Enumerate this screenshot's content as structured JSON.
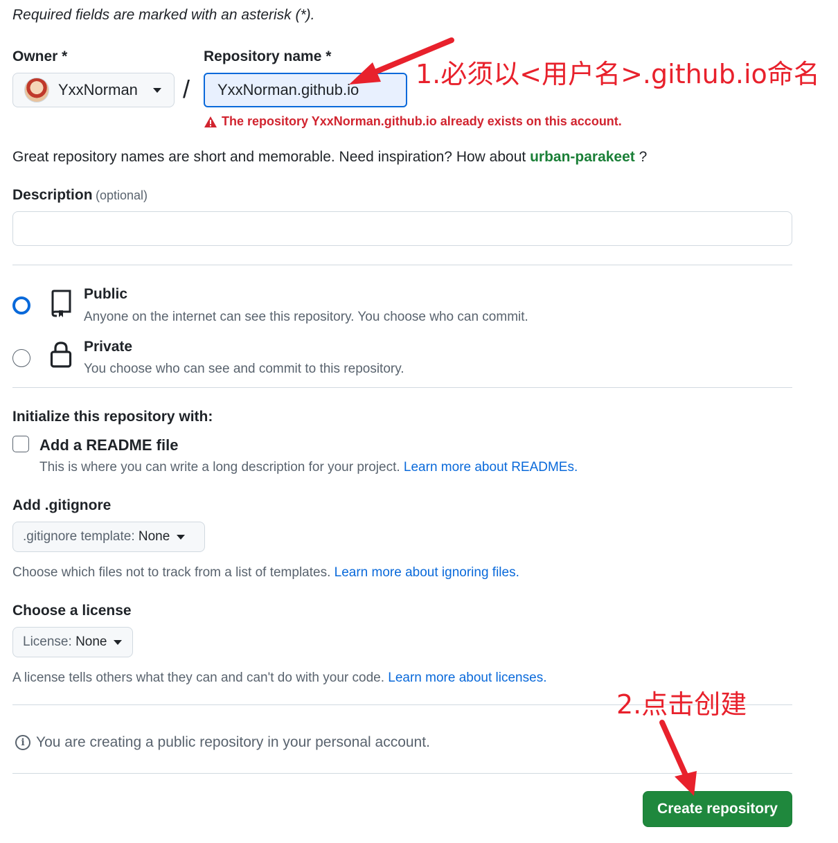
{
  "form": {
    "required_note": "Required fields are marked with an asterisk (*).",
    "owner_label": "Owner *",
    "owner_name": "YxxNorman",
    "slash": "/",
    "repo_label": "Repository name *",
    "repo_value": "YxxNorman.github.io",
    "repo_error": "The repository YxxNorman.github.io already exists on this account.",
    "inspiration_text": "Great repository names are short and memorable. Need inspiration? How about",
    "suggestion": "urban-parakeet",
    "inspiration_end": "?",
    "description_label": "Description",
    "description_optional": "(optional)",
    "description_value": ""
  },
  "visibility": {
    "public_title": "Public",
    "public_desc": "Anyone on the internet can see this repository. You choose who can commit.",
    "private_title": "Private",
    "private_desc": "You choose who can see and commit to this repository.",
    "selected": "public"
  },
  "initialize": {
    "heading": "Initialize this repository with:",
    "readme_label": "Add a README file",
    "readme_checked": false,
    "readme_desc": "This is where you can write a long description for your project.",
    "readme_link": "Learn more about READMEs.",
    "gitignore_heading": "Add .gitignore",
    "gitignore_prefix": ".gitignore template:",
    "gitignore_value": "None",
    "gitignore_hint": "Choose which files not to track from a list of templates.",
    "gitignore_link": "Learn more about ignoring files.",
    "license_heading": "Choose a license",
    "license_prefix": "License:",
    "license_value": "None",
    "license_hint": "A license tells others what they can and can't do with your code.",
    "license_link": "Learn more about licenses."
  },
  "footer": {
    "info_note": "You are creating a public repository in your personal account.",
    "create_button": "Create repository"
  },
  "annotations": {
    "note1": "1.必须以<用户名>.github.io命名",
    "note2": "2.点击创建",
    "color": "#e8212c"
  },
  "icons": {
    "owner_avatar": "avatar",
    "dropdown": "caret-down-icon",
    "error": "alert-icon",
    "public": "repo-icon",
    "private": "lock-icon",
    "info": "info-icon"
  }
}
